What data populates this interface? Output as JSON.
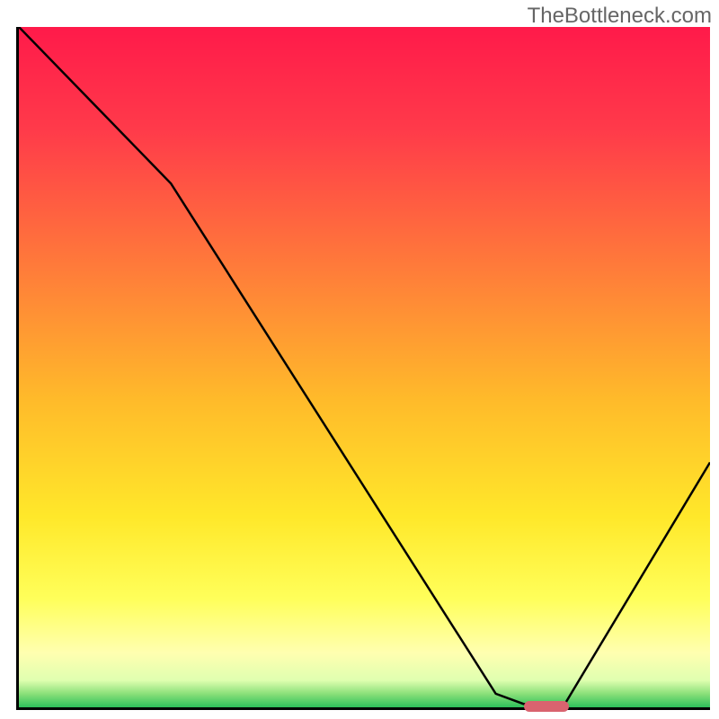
{
  "watermark": "TheBottleneck.com",
  "chart_data": {
    "type": "line",
    "title": "",
    "xlabel": "",
    "ylabel": "",
    "xlim": [
      0,
      100
    ],
    "ylim": [
      0,
      100
    ],
    "x": [
      0,
      22,
      69,
      73,
      79,
      100
    ],
    "values": [
      100,
      77,
      2,
      0.5,
      0.5,
      36
    ],
    "marker": {
      "x_start": 73,
      "x_end": 79,
      "y": 0.5,
      "color": "#d9636f"
    },
    "gradient_stops": [
      {
        "offset": 0,
        "color": "#ff1a4a"
      },
      {
        "offset": 15,
        "color": "#ff3a4a"
      },
      {
        "offset": 35,
        "color": "#ff7a3a"
      },
      {
        "offset": 55,
        "color": "#ffbb2a"
      },
      {
        "offset": 72,
        "color": "#ffe82a"
      },
      {
        "offset": 84,
        "color": "#ffff5a"
      },
      {
        "offset": 92,
        "color": "#ffffb0"
      },
      {
        "offset": 96,
        "color": "#e0ffb0"
      },
      {
        "offset": 98,
        "color": "#8be07a"
      },
      {
        "offset": 100,
        "color": "#2dbf5a"
      }
    ]
  }
}
